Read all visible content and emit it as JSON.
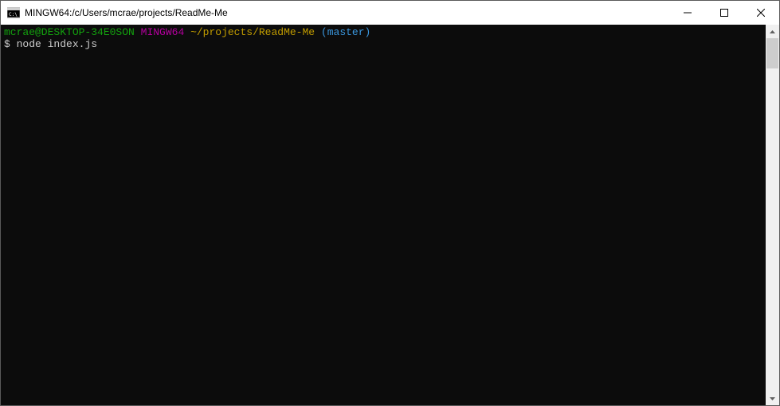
{
  "window": {
    "title": "MINGW64:/c/Users/mcrae/projects/ReadMe-Me"
  },
  "prompt": {
    "user_host": "mcrae@DESKTOP-34E0SON",
    "env": "MINGW64",
    "path": "~/projects/ReadMe-Me",
    "branch_open": "(",
    "branch": "master",
    "branch_close": ")",
    "symbol": "$",
    "command": "node index.js"
  }
}
